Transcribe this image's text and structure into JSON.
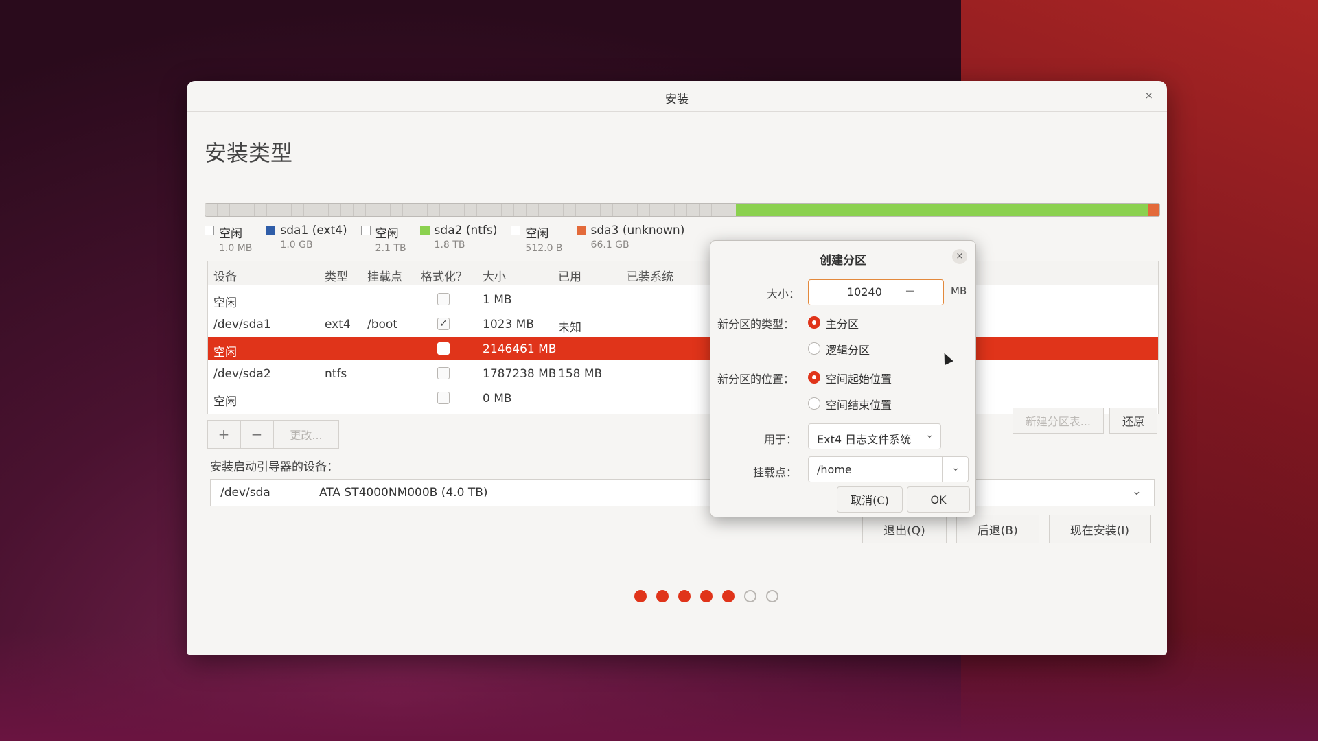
{
  "window": {
    "title": "安装",
    "close_glyph": "×",
    "page_title": "安装类型"
  },
  "disk_bar": {
    "segments": [
      {
        "kind": "free",
        "fraction": 0.5561
      },
      {
        "kind": "ntfs",
        "fraction": 0.4319,
        "color": "#8bd14f"
      },
      {
        "kind": "unknown",
        "fraction": 0.012,
        "color": "#e36a3a"
      }
    ]
  },
  "legend": [
    {
      "name": "空闲",
      "size": "1.0 MB",
      "color": "#ffffff",
      "checkbox": true
    },
    {
      "name": "sda1 (ext4)",
      "size": "1.0 GB",
      "color": "#2f5da8"
    },
    {
      "name": "空闲",
      "size": "2.1 TB",
      "color": "#ffffff",
      "checkbox": true
    },
    {
      "name": "sda2 (ntfs)",
      "size": "1.8 TB",
      "color": "#8bd14f"
    },
    {
      "name": "空闲",
      "size": "512.0 B",
      "color": "#ffffff",
      "checkbox": true
    },
    {
      "name": "sda3 (unknown)",
      "size": "66.1 GB",
      "color": "#e36a3a"
    }
  ],
  "table": {
    "headers": {
      "device": "设备",
      "type": "类型",
      "mount": "挂载点",
      "format": "格式化？",
      "size": "大小",
      "used": "已用",
      "installed": "已装系统"
    },
    "rows": [
      {
        "device": "空闲",
        "type": "",
        "mount": "",
        "format": false,
        "size": "1 MB",
        "used": "",
        "selected": false
      },
      {
        "device": "/dev/sda1",
        "type": "ext4",
        "mount": "/boot",
        "format": true,
        "size": "1023 MB",
        "used": "未知",
        "selected": false
      },
      {
        "device": "空闲",
        "type": "",
        "mount": "",
        "format": false,
        "size": "2146461 MB",
        "used": "",
        "selected": true
      },
      {
        "device": "/dev/sda2",
        "type": "ntfs",
        "mount": "",
        "format": false,
        "size": "1787238 MB",
        "used": "158 MB",
        "selected": false
      },
      {
        "device": "空闲",
        "type": "",
        "mount": "",
        "format": false,
        "size": "0 MB",
        "used": "",
        "selected": false
      }
    ],
    "check_glyph": "✓"
  },
  "table_buttons": {
    "add": "+",
    "remove": "−",
    "change": "更改..."
  },
  "right_buttons": {
    "new_table": "新建分区表...",
    "revert": "还原"
  },
  "boot": {
    "label": "安装启动引导器的设备：",
    "device": "/dev/sda",
    "model": "ATA ST4000NM000B (4.0 TB)",
    "chevron": "⌄"
  },
  "nav_buttons": {
    "quit": "退出(Q)",
    "back": "后退(B)",
    "install_now": "现在安装(I)"
  },
  "progress": {
    "total_steps": 7,
    "completed_steps": 5,
    "on_color": "#e0341a"
  },
  "dialog": {
    "title": "创建分区",
    "close_glyph": "×",
    "size_label": "大小：",
    "size_value": "10240",
    "size_minus": "−",
    "size_unit": "MB",
    "type_label": "新分区的类型：",
    "type_primary": "主分区",
    "type_logical": "逻辑分区",
    "location_label": "新分区的位置：",
    "location_start": "空间起始位置",
    "location_end": "空间结束位置",
    "use_label": "用于：",
    "use_value": "Ext4 日志文件系统",
    "mount_label": "挂载点：",
    "mount_value": "/home",
    "chevron": "⌄",
    "cancel": "取消(C)",
    "ok": "OK"
  }
}
